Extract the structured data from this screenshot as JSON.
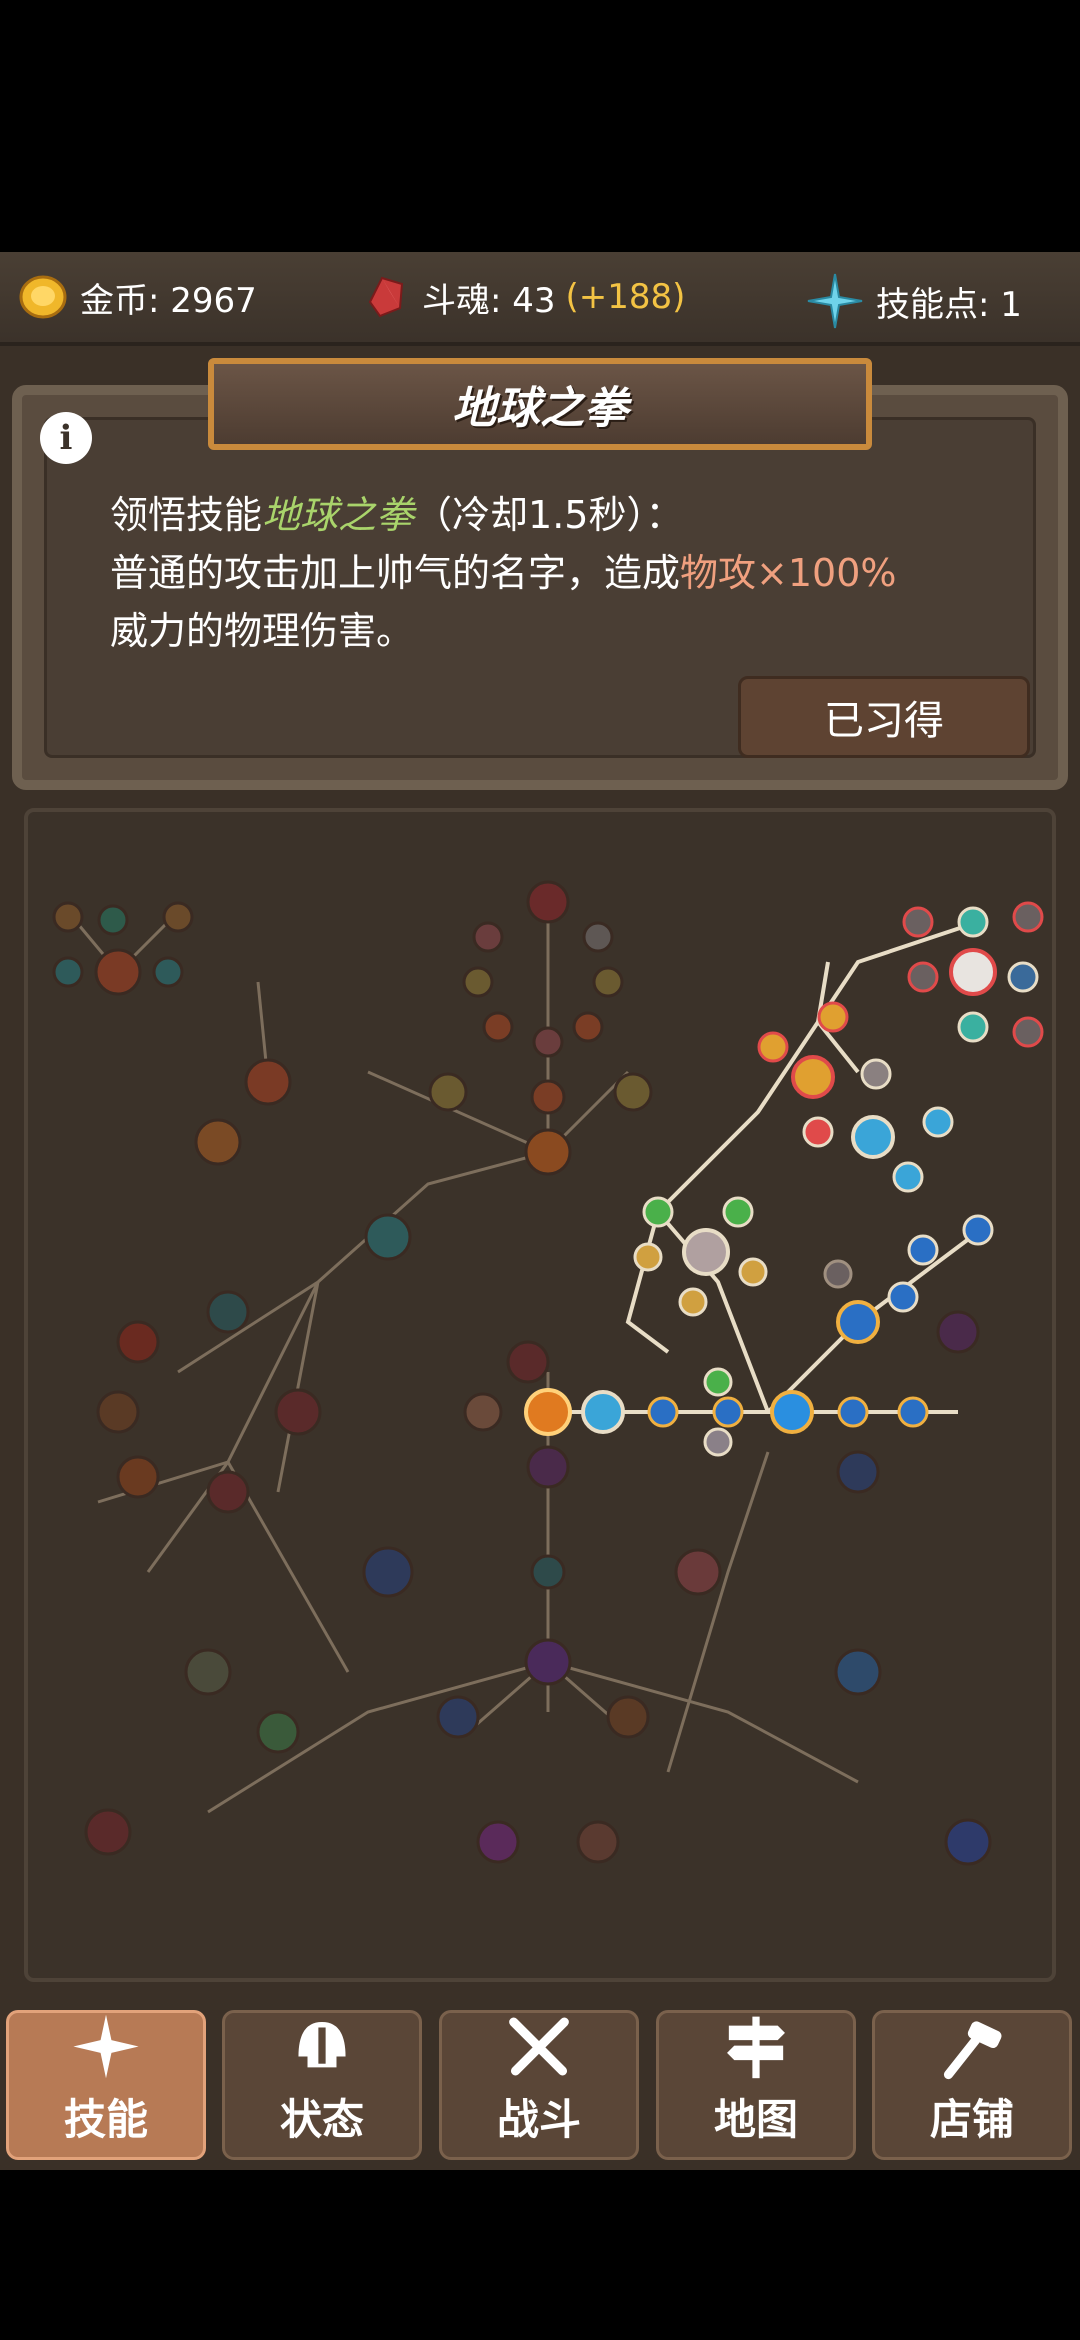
{
  "resources": {
    "gold_label": "金币: 2967",
    "soul_label": "斗魂: 43",
    "soul_gain": "(+188)",
    "skillpoints_label": "技能点: 1"
  },
  "skill": {
    "title": "地球之拳",
    "desc_prefix": "领悟技能",
    "skill_name": "地球之拳",
    "cooldown": "（冷却1.5秒）：",
    "line2_prefix": "普通的攻击加上帅气的名字，造成",
    "damage": "物攻×100%",
    "line3": "威力的物理伤害。",
    "learned_button": "已习得"
  },
  "nav": {
    "tabs": [
      {
        "label": "技能",
        "icon": "sparkle-icon",
        "active": true
      },
      {
        "label": "状态",
        "icon": "helmet-icon",
        "active": false
      },
      {
        "label": "战斗",
        "icon": "crossed-swords-icon",
        "active": false
      },
      {
        "label": "地图",
        "icon": "signpost-icon",
        "active": false
      },
      {
        "label": "店铺",
        "icon": "hammer-icon",
        "active": false
      }
    ]
  },
  "colors": {
    "gold": "#f3c344",
    "skill_green": "#a9d46b",
    "damage_pink": "#f0a07f",
    "active_tab": "#b77a55"
  }
}
